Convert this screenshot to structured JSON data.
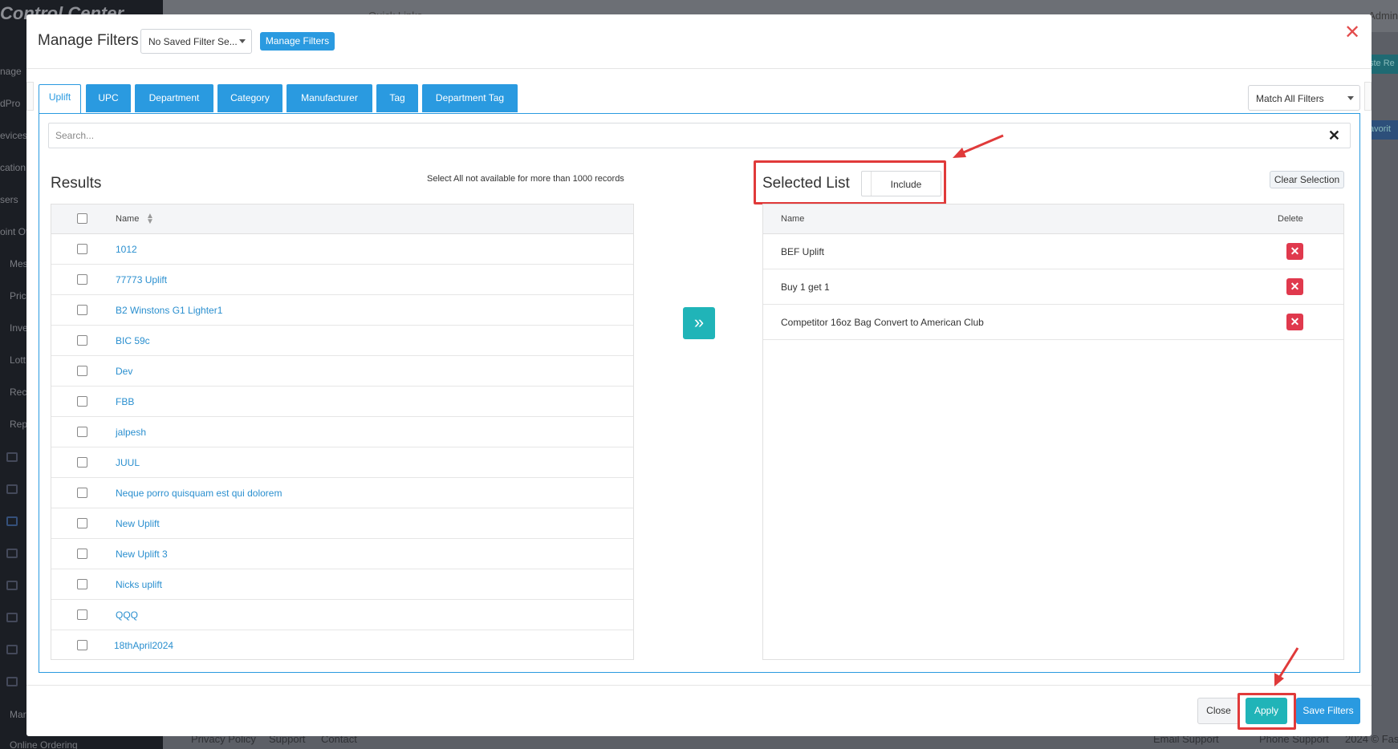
{
  "background": {
    "brand": "Control Center",
    "sidebar_items": [
      "nage",
      "dPro",
      "evices",
      "cation",
      "sers",
      "oint Of",
      "Mes",
      "Pric",
      "Inve",
      "Lott",
      "Rec",
      "Rep"
    ],
    "sidebar_bottom": "Online Ordering",
    "sidebar_bottom2": "Mar",
    "top_link": "Quick Links",
    "admin": "Admin",
    "right_buttons": [
      "ste Re",
      "avorit"
    ],
    "footer_links": [
      "Privacy Policy",
      "Support",
      "Contact"
    ],
    "footer_right": [
      "Email Support",
      "Phone Support",
      "2024 © Fas"
    ]
  },
  "modal": {
    "title": "Manage Filters",
    "saved_filter_select": "No Saved Filter Se...",
    "manage_button": "Manage Filters",
    "tabs": [
      "Uplift",
      "UPC",
      "Department",
      "Category",
      "Manufacturer",
      "Tag",
      "Department Tag"
    ],
    "active_tab": "Uplift",
    "match_select": "Match All Filters",
    "search": {
      "placeholder": "Search...",
      "value": ""
    },
    "results": {
      "title": "Results",
      "note": "Select All not available for more than 1000 records",
      "column_name": "Name",
      "rows": [
        "1012",
        "77773 Uplift",
        "B2 Winstons G1 Lighter1",
        "BIC 59c",
        "Dev",
        "FBB",
        "jalpesh",
        "JUUL",
        "Neque porro quisquam est qui dolorem",
        "New Uplift",
        "New Uplift 3",
        "Nicks uplift",
        "QQQ",
        "18thApril2024"
      ]
    },
    "selected": {
      "title": "Selected List",
      "toggle_label": "Include",
      "clear_button": "Clear Selection",
      "column_name": "Name",
      "column_delete": "Delete",
      "rows": [
        "BEF Uplift",
        "Buy 1 get 1",
        "Competitor 16oz Bag Convert to American Club"
      ]
    },
    "footer": {
      "close": "Close",
      "apply": "Apply",
      "save": "Save Filters"
    }
  },
  "colors": {
    "primary": "#2a9ae0",
    "teal": "#20b4b8",
    "danger": "#e0394d",
    "annotation": "#e03a3a"
  }
}
